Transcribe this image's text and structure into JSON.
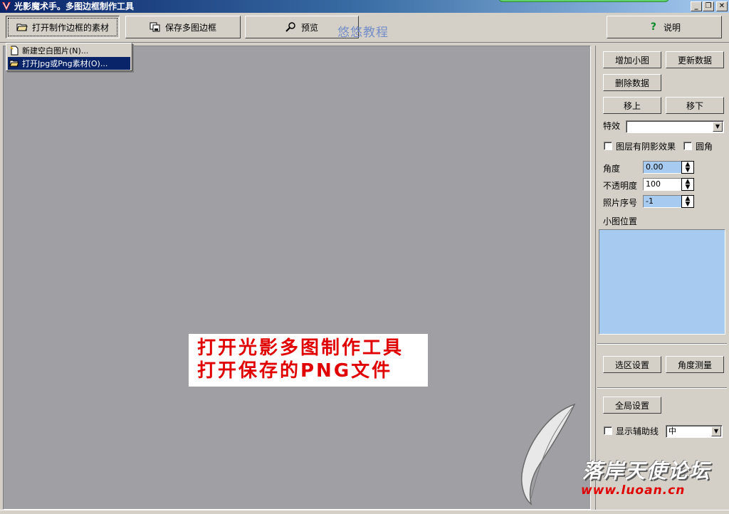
{
  "window": {
    "title": "光影魔术手。多图边框制作工具",
    "minimize": "_",
    "restore": "❐",
    "close": "✕"
  },
  "toolbar": {
    "open_material": "打开制作边框的素材",
    "save_frame": "保存多图边框",
    "preview": "预览",
    "help": "说明",
    "watermark": "悠悠教程"
  },
  "menu": {
    "items": [
      {
        "label": "新建空白图片(N)..."
      },
      {
        "label": "打开Jpg或Png素材(O)..."
      }
    ]
  },
  "canvas": {
    "banner_line1": "打开光影多图制作工具",
    "banner_line2": "打开保存的PNG文件"
  },
  "panel": {
    "add_thumb": "增加小图",
    "update_data": "更新数据",
    "delete_data": "删除数据",
    "move_up": "移上",
    "move_down": "移下",
    "effect_label": "特效",
    "effect_value": "",
    "shadow_label": "图层有阴影效果",
    "round_label": "圆角",
    "angle_label": "角度",
    "angle_value": "0.00",
    "opacity_label": "不透明度",
    "opacity_value": "100",
    "photo_index_label": "照片序号",
    "photo_index_value": "-1",
    "position_label": "小图位置",
    "selection_settings": "选区设置",
    "angle_measure": "角度测量",
    "global_settings": "全局设置",
    "guide_label": "显示辅助线",
    "guide_value": "中"
  },
  "logo": {
    "text": "落岸天使论坛",
    "url": "www.luoan.cn"
  },
  "colors": {
    "titlebar": "#0a246a",
    "canvas": "#a09fa3",
    "banner_text": "#e00000",
    "input_highlight": "#a6caf0"
  }
}
